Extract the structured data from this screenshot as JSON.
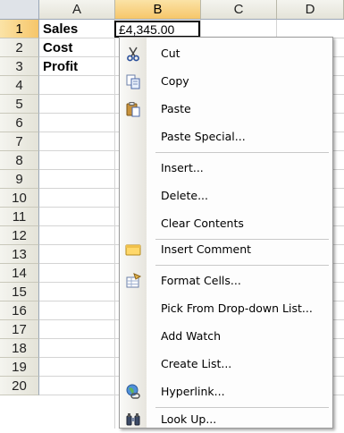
{
  "spreadsheet": {
    "columns": [
      "A",
      "B",
      "C",
      "D"
    ],
    "selected_column": "B",
    "rows": [
      "1",
      "2",
      "3",
      "4",
      "5",
      "6",
      "7",
      "8",
      "9",
      "10",
      "11",
      "12",
      "13",
      "14",
      "15",
      "16",
      "17",
      "18",
      "19",
      "20"
    ],
    "selected_row": "1",
    "cells": {
      "A1": "Sales",
      "A2": "Cost",
      "A3": "Profit",
      "B1": "£4,345.00"
    }
  },
  "context_menu": {
    "items": [
      {
        "label": "Cut",
        "icon": "scissors-icon"
      },
      {
        "label": "Copy",
        "icon": "copy-icon"
      },
      {
        "label": "Paste",
        "icon": "clipboard-paste-icon"
      },
      {
        "label": "Paste Special...",
        "icon": ""
      },
      {
        "label": "Insert...",
        "icon": ""
      },
      {
        "label": "Delete...",
        "icon": ""
      },
      {
        "label": "Clear Contents",
        "icon": ""
      },
      {
        "label": "Insert Comment",
        "icon": "comment-icon"
      },
      {
        "label": "Format Cells...",
        "icon": "format-cells-icon"
      },
      {
        "label": "Pick From Drop-down List...",
        "icon": ""
      },
      {
        "label": "Add Watch",
        "icon": ""
      },
      {
        "label": "Create List...",
        "icon": ""
      },
      {
        "label": "Hyperlink...",
        "icon": "hyperlink-globe-icon"
      },
      {
        "label": "Look Up...",
        "icon": "binoculars-icon"
      }
    ]
  }
}
